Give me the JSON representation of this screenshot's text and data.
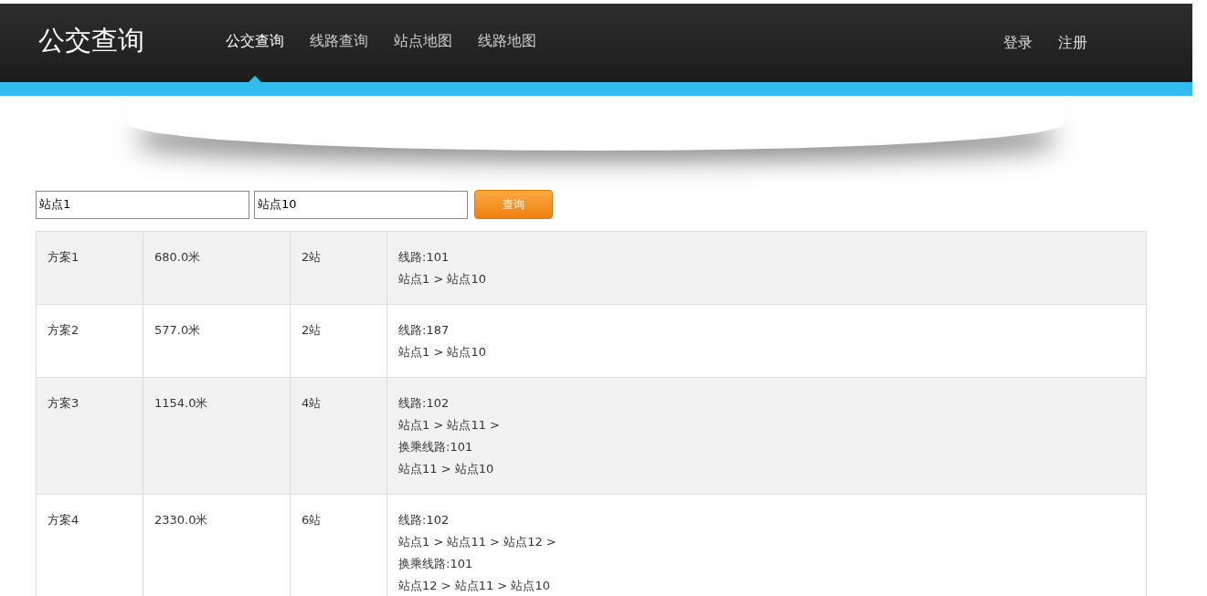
{
  "header": {
    "logo": "公交查询",
    "nav": [
      {
        "label": "公交查询",
        "selected": true
      },
      {
        "label": "线路查询",
        "selected": false
      },
      {
        "label": "站点地图",
        "selected": false
      },
      {
        "label": "线路地图",
        "selected": false
      }
    ],
    "account": [
      "登录",
      "注册"
    ]
  },
  "search": {
    "from": "站点1",
    "to": "站点10",
    "button": "查询"
  },
  "plans": [
    {
      "name": "方案1",
      "distance": "680.0米",
      "stops": "2站",
      "lines": [
        "线路:101",
        "站点1 > 站点10"
      ]
    },
    {
      "name": "方案2",
      "distance": "577.0米",
      "stops": "2站",
      "lines": [
        "线路:187",
        "站点1 > 站点10"
      ]
    },
    {
      "name": "方案3",
      "distance": "1154.0米",
      "stops": "4站",
      "lines": [
        "线路:102",
        "站点1 > 站点11 >",
        "换乘线路:101",
        "站点11 > 站点10"
      ]
    },
    {
      "name": "方案4",
      "distance": "2330.0米",
      "stops": "6站",
      "lines": [
        "线路:102",
        "站点1 > 站点11 > 站点12 >",
        "换乘线路:101",
        "站点12 > 站点11 > 站点10"
      ]
    }
  ]
}
